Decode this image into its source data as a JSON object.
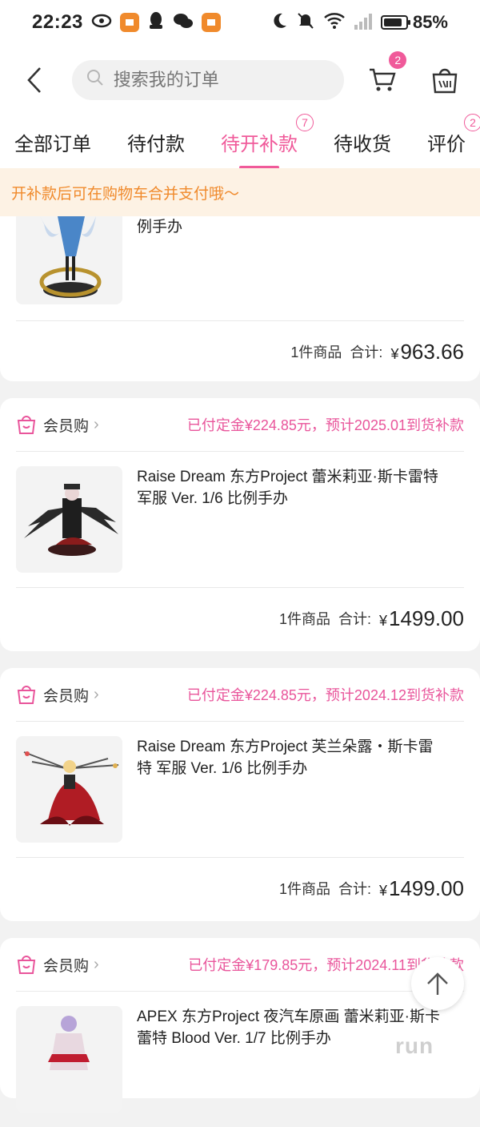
{
  "status": {
    "time": "22:23",
    "battery": "85%"
  },
  "header": {
    "search_placeholder": "搜索我的订单",
    "cart_badge": "2"
  },
  "tabs": [
    {
      "label": "全部订单"
    },
    {
      "label": "待付款"
    },
    {
      "label": "待开补款",
      "badge": "7"
    },
    {
      "label": "待收货"
    },
    {
      "label": "评价",
      "badge": "2"
    }
  ],
  "notice": "开补款后可在购物车合并支付哦～",
  "orders": [
    {
      "title_tail": "例手办",
      "qty": "1件商品",
      "total_label": "合计:",
      "price": "963.66"
    },
    {
      "member": "会员购",
      "deposit": "已付定金¥224.85元，预计2025.01到货补款",
      "title": "Raise Dream 东方Project 蕾米莉亚·斯卡雷特 军服 Ver. 1/6 比例手办",
      "qty": "1件商品",
      "total_label": "合计:",
      "price": "1499.00"
    },
    {
      "member": "会员购",
      "deposit": "已付定金¥224.85元，预计2024.12到货补款",
      "title": "Raise Dream 东方Project 芙兰朵露・斯卡雷特 军服 Ver. 1/6 比例手办",
      "qty": "1件商品",
      "total_label": "合计:",
      "price": "1499.00"
    },
    {
      "member": "会员购",
      "deposit": "已付定金¥179.85元，预计2024.11到货补款",
      "title": "APEX 东方Project 夜汽车原画 蕾米莉亚·斯卡蕾特 Blood Ver. 1/7 比例手办"
    }
  ],
  "currency": "¥",
  "watermark": "run",
  "colors": {
    "accent": "#f05a9a",
    "notice_text": "#f08a2c",
    "notice_bg": "#fdf2e4"
  }
}
